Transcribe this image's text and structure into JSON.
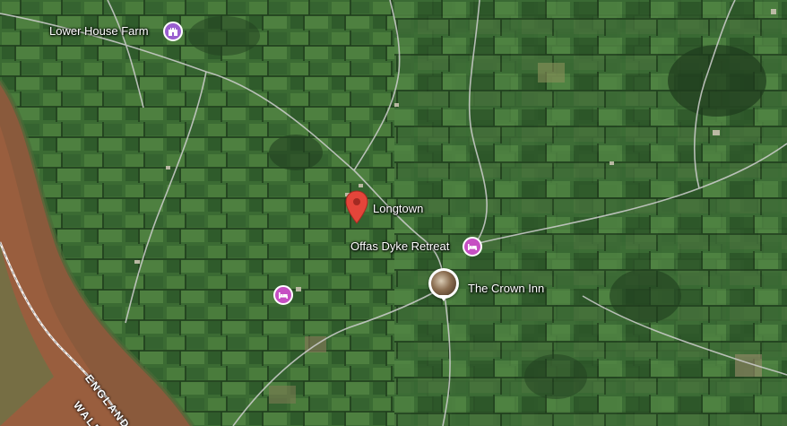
{
  "map": {
    "places": {
      "lower_house_farm": "Lower House Farm",
      "longtown": "Longtown",
      "offas_dyke_retreat": "Offas Dyke Retreat",
      "crown_inn": "The Crown Inn"
    },
    "border": {
      "england": "ENGLAND",
      "wales": "WALES"
    },
    "icons": {
      "farm": "castle-icon",
      "pin": "red-location-pin-icon",
      "hotel": "bed-icon",
      "photo": "photo-pin-icon"
    },
    "colors": {
      "field_dark": "#254b23",
      "field_mid": "#3b6b33",
      "field_light": "#5a8a48",
      "moorland": "#8a5a3c",
      "pin_red": "#e4453a",
      "poi_purple": "#c64fc3",
      "road": "#cfcfcf"
    }
  }
}
